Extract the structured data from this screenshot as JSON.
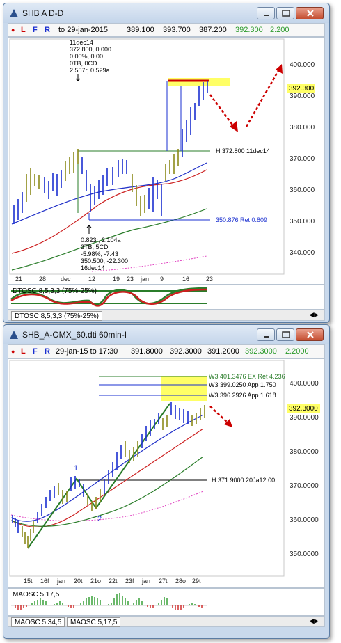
{
  "colors": {
    "accent_green": "#2a7d2a",
    "price_up": "#1a2fd0",
    "price_alt": "#8c8a1a",
    "target": "#ffff66",
    "red": "#cc0000"
  },
  "top": {
    "title": "SHB A D-D",
    "toolbar": {
      "dot": "●",
      "l": "L",
      "f": "F",
      "r": "R",
      "date": "to 29-jan-2015",
      "open": "389.100",
      "high": "393.700",
      "low": "387.200",
      "close": "392.300",
      "change": "2.200"
    },
    "y_ticks": [
      "400.000",
      "390.000",
      "380.000",
      "370.000",
      "360.000",
      "350.000",
      "340.000"
    ],
    "last_price": "392.300",
    "x_ticks": [
      "21",
      "28",
      "dec",
      "12",
      "19",
      "23",
      "jan",
      "9",
      "16",
      "23"
    ],
    "note_top": [
      "11dec14",
      "372.800, 0.000",
      "0.00%, 0.00",
      "0TB, 0CD",
      "2.557r, 0.529a"
    ],
    "note_bottom": [
      "0.823r, 2.104a",
      "3TB, 5CD",
      "-5.98%, -7.43",
      "350.500, -22.300",
      "16dec14"
    ],
    "h_label": "H  372.800  11dec14",
    "ret_label": "350.876  Ret 0.809",
    "osc_label": "DTOSC 8,5,3,3 (75%-25%)",
    "tab": "DTOSC 8,5,3,3 (75%-25%)"
  },
  "bottom": {
    "title": "SHB_A-OMX_60.dti 60min-I",
    "toolbar": {
      "dot": "●",
      "l": "L",
      "f": "F",
      "r": "R",
      "date": "29-jan-15 to 17:30",
      "open": "391.8000",
      "high": "392.3000",
      "low": "391.2000",
      "close": "392.3000",
      "change": "2.2000"
    },
    "y_ticks": [
      "400.0000",
      "390.0000",
      "380.0000",
      "370.0000",
      "360.0000",
      "350.0000"
    ],
    "last_price": "392.3000",
    "x_ticks": [
      "15t",
      "16f",
      "jan",
      "20t",
      "21o",
      "22t",
      "23f",
      "jan",
      "27t",
      "28o",
      "29t"
    ],
    "w3_labels": [
      "W3  401.3476  EX Ret 4.236",
      "W3  399.0250  App 1.750",
      "W3  396.2926  App 1.618"
    ],
    "h_label": "H  371.9000  20Ja12:00",
    "wave_1": "1",
    "wave_2": "2",
    "osc_label": "MAOSC 5,17,5",
    "tabs": [
      "MAOSC 5,34,5",
      "MAOSC 5,17,5"
    ]
  }
}
